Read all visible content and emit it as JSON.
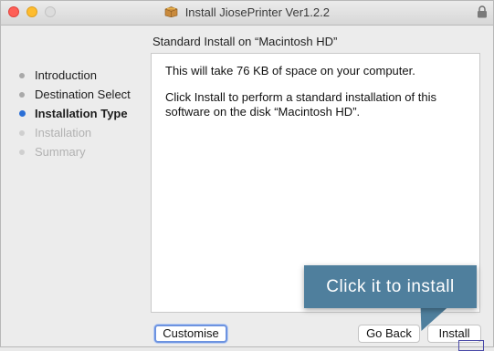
{
  "window": {
    "title": "Install JiosePrinter Ver1.2.2",
    "title_icon": "package-box-icon",
    "lock_icon": "lock-icon"
  },
  "subtitle": "Standard Install on “Macintosh HD”",
  "steps": [
    {
      "label": "Introduction",
      "state": "done"
    },
    {
      "label": "Destination Select",
      "state": "done"
    },
    {
      "label": "Installation Type",
      "state": "current"
    },
    {
      "label": "Installation",
      "state": "disabled"
    },
    {
      "label": "Summary",
      "state": "disabled"
    }
  ],
  "content": {
    "line1": "This will take 76 KB of space on your computer.",
    "line2": "Click Install to perform a standard installation of this software on the disk “Macintosh HD”."
  },
  "buttons": {
    "customise": "Customise",
    "go_back": "Go Back",
    "install": "Install"
  },
  "tooltip": {
    "text": "Click it to install"
  },
  "colors": {
    "accent": "#2b6fd6",
    "tooltip_bg": "#4f7f9d"
  }
}
